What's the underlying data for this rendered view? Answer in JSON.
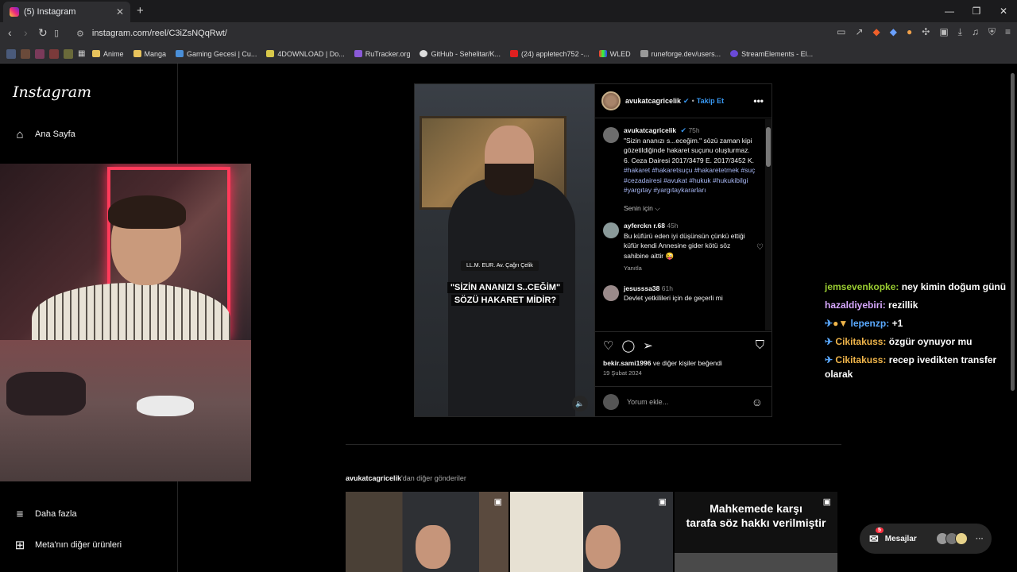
{
  "browser": {
    "tab_title": "(5) Instagram",
    "url": "instagram.com/reel/C3iZsNQqRwt/",
    "bookmarks": [
      "Anime",
      "Manga",
      "Gaming Gecesi | Cu...",
      "4DOWNLOAD | Do...",
      "RuTracker.org",
      "GitHub - Sehelitar/K...",
      "(24) appletech752 -...",
      "WLED",
      "runeforge.dev/users...",
      "StreamElements - El..."
    ]
  },
  "sidebar": {
    "logo": "Instagram",
    "home": "Ana Sayfa",
    "more": "Daha fazla",
    "meta": "Meta'nın diğer ürünleri"
  },
  "post": {
    "author": "avukatcagricelik",
    "follow": "Takip Et",
    "caption_time": "75h",
    "caption_text": "\"Sizin ananızı s...eceğim.\" sözü zaman kipi gözetildiğinde hakaret suçunu oluşturmaz.",
    "caption_ref": "6. Ceza Dairesi 2017/3479 E. 2017/3452 K.",
    "hashtags": "#hakaret #hakaretsuçu #hakaretetmek #suç #cezadairesi #avukat #hukuk #hukukibilgi #yargıtay #yargıtaykararları",
    "senin_icin": "Senin için ⌵",
    "comment1_user": "ayferckn r.68",
    "comment1_time": "45h",
    "comment1_text": "Bu küfürü eden iyi düşünsün çünkü ettiği küfür kendi Annesine gider kötü söz sahibine aittir 😜",
    "comment1_reply": "Yanıtla",
    "comment2_user": "jesusssa38",
    "comment2_time": "61h",
    "comment2_text": "Devlet yetkilileri için de geçerli mi",
    "likes_user": "bekir.sami1996",
    "likes_rest": "ve diğer kişiler beğendi",
    "date": "19 Şubat 2024",
    "comment_placeholder": "Yorum ekle...",
    "video_label_small": "LL.M. EUR. Av. Çağrı Çelik",
    "video_label_1": "\"SİZİN ANANIZI S..CEĞİM\"",
    "video_label_2": "SÖZÜ HAKARET MİDİR?"
  },
  "more_posts": {
    "user": "avukatcagricelik",
    "suffix": "'dan diğer gönderiler",
    "thumb3_line1": "Mahkemede karşı",
    "thumb3_line2": "tarafa söz hakkı verilmiştir"
  },
  "chat": [
    {
      "name": "jemsevenkopke:",
      "text": "ney kimin doğum günü"
    },
    {
      "name": "hazaldiyebiri:",
      "text": "rezillik"
    },
    {
      "name": "lepenzp:",
      "text": "+1"
    },
    {
      "name": "Cikitakuss:",
      "text": "özgür oynuyor mu"
    },
    {
      "name": "Cikitakuss:",
      "text": "recep ivedikten transfer olarak"
    }
  ],
  "messages": {
    "label": "Mesajlar",
    "count": "5"
  },
  "colors": {
    "accent": "#3897f0",
    "background": "#000000"
  }
}
